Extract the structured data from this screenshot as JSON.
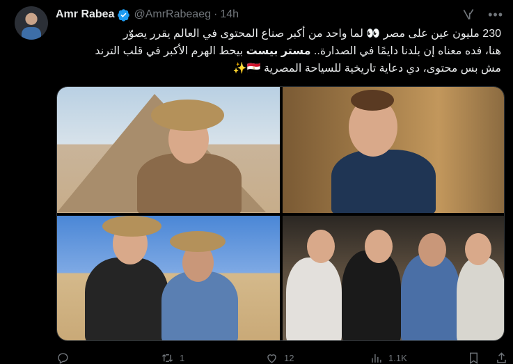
{
  "tweet": {
    "author_name": "Amr Rabea",
    "handle": "@AmrRabeaeg",
    "separator": "·",
    "time": "14h",
    "text_lines": [
      "230 مليون عين على مصر 👀 لما واحد من أكبر صناع المحتوى في العالم يقرر يصوّر",
      "هنا، فده معناه إن بلدنا دايمًا في الصدارة.. ",
      "مش بس محتوى، دي دعاية تاريخية للسياحة المصرية 🇪🇬✨"
    ],
    "line2_bold": "مستر بيست",
    "line2_rest": " بيحط الهرم الأكبر في قلب الترند",
    "icons": {
      "verified": "verified-badge-icon",
      "grok": "grok-icon",
      "more": "more-icon"
    }
  },
  "media": {
    "count": 4
  },
  "actions": {
    "reply_count": "",
    "retweet_count": "1",
    "like_count": "12",
    "views_count": "1.1K"
  },
  "colors": {
    "background": "#000000",
    "text": "#e7e9ea",
    "muted": "#71767b",
    "verified": "#1d9bf0"
  }
}
